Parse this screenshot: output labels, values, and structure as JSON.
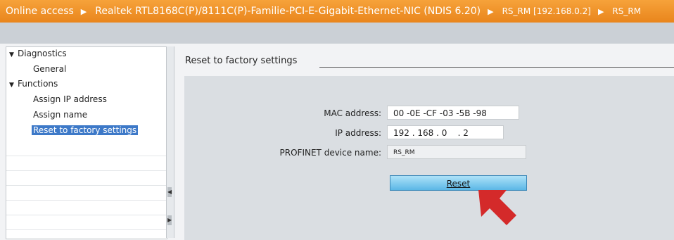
{
  "titlebar": {
    "crumb1": "Online access",
    "crumb2": "Realtek RTL8168C(P)/8111C(P)-Familie-PCI-E-Gigabit-Ethernet-NIC (NDIS 6.20)",
    "crumb3": "RS_RM [192.168.0.2]",
    "crumb4": "RS_RM"
  },
  "tree": {
    "diagnostics": "Diagnostics",
    "general": "General",
    "functions": "Functions",
    "assign_ip": "Assign IP address",
    "assign_name": "Assign name",
    "reset_factory": "Reset to factory settings"
  },
  "panel": {
    "title": "Reset to factory settings",
    "mac_label": "MAC address:",
    "mac_value": "00 -0E -CF -03 -5B -98",
    "ip_label": "IP address:",
    "ip_value": "192 . 168 . 0    . 2",
    "profinet_label": "PROFINET device name:",
    "profinet_value": "RS_RM",
    "reset_button": "Reset"
  },
  "colors": {
    "titlebar": "#ee8f25",
    "selected": "#3d79c8",
    "button": "#6ec1ea",
    "pointer_arrow": "#d42a2a"
  }
}
